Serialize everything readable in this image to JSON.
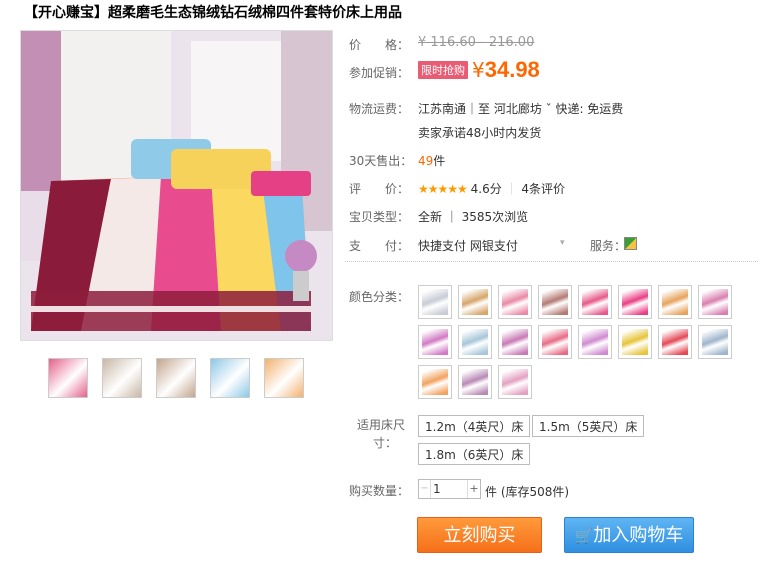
{
  "title": "【开心赚宝】超柔磨毛生态锦绒钻石绒棉四件套特价床上用品",
  "price": {
    "label": "价　　格：",
    "original": "¥ 116.60 - 216.00"
  },
  "promo": {
    "label": "参加促销：",
    "tag": "限时抢购",
    "currency": "¥",
    "price": "34.98"
  },
  "shipping": {
    "label": "物流运费：",
    "route": "江苏南通｜至  河北廊坊 ˇ   快递: 免运费",
    "promise": "卖家承诺48小时内发货"
  },
  "sales": {
    "label": "30天售出：",
    "count": "49",
    "unit": "件"
  },
  "rating": {
    "label": "评　　价：",
    "stars": "★★★★★",
    "score": "4.6分",
    "sep": "｜",
    "reviews": "4条评价"
  },
  "type": {
    "label": "宝贝类型：",
    "value": "全新  ｜  3585次浏览"
  },
  "payment": {
    "label": "支　　付：",
    "methods": "快捷支付   网银支付",
    "service_label": "服务："
  },
  "colors": {
    "label": "颜色分类：",
    "swatches": [
      "#c9ccd6",
      "#d7a66a",
      "#e98aa7",
      "#b47b74",
      "#e65a8a",
      "#ea3f85",
      "#e7a35d",
      "#d97fb0",
      "#d27bc4",
      "#a7c6d9",
      "#c87ab5",
      "#e86b86",
      "#d08bd0",
      "#e7c43a",
      "#e44a58",
      "#9fb5cc",
      "#f2a35f",
      "#b88ab6",
      "#e4a1c1"
    ]
  },
  "thumbs": {
    "colors": [
      "#e5608a",
      "#c8b7a4",
      "#c3a48c",
      "#8cc7e6",
      "#f2b16d"
    ]
  },
  "size": {
    "label_line1": "适用床尺",
    "label_line2": "寸：",
    "options": [
      "1.2m（4英尺）床",
      "1.5m（5英尺）床",
      "1.8m（6英尺）床"
    ]
  },
  "quantity": {
    "label": "购买数量：",
    "value": "1",
    "stock": "件 (库存508件)"
  },
  "buttons": {
    "buy": "立刻购买",
    "cart": "加入购物车"
  }
}
